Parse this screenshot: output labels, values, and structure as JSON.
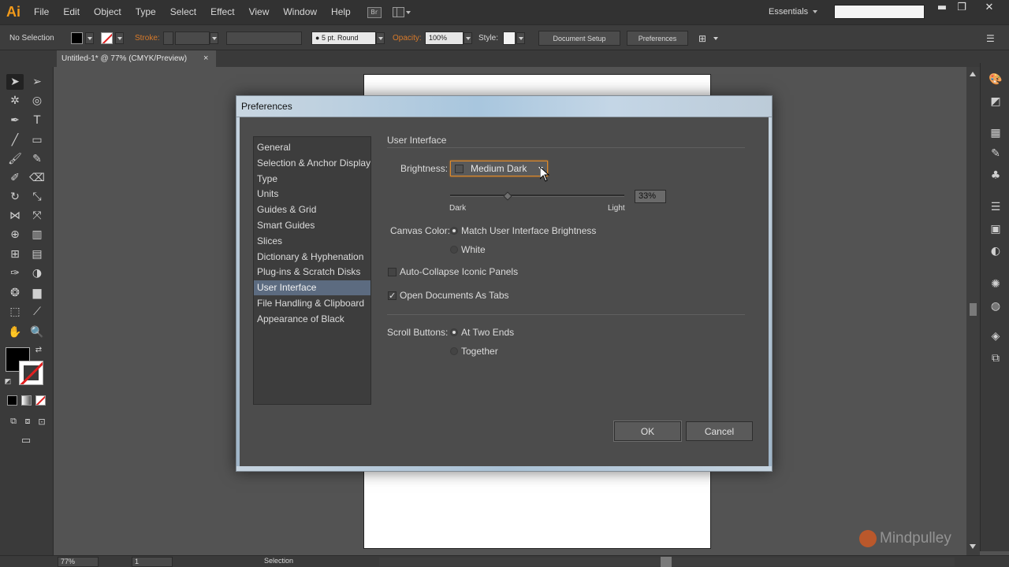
{
  "app": {
    "logo": "Ai",
    "menu": [
      "File",
      "Edit",
      "Object",
      "Type",
      "Select",
      "Effect",
      "View",
      "Window",
      "Help"
    ],
    "workspace": "Essentials",
    "window_controls": {
      "minimize": "▬",
      "restore": "❐",
      "close": "✕"
    }
  },
  "control_bar": {
    "selection_state": "No Selection",
    "stroke_label": "Stroke:",
    "brush_value": "5 pt. Round",
    "opacity_label": "Opacity:",
    "opacity_value": "100%",
    "style_label": "Style:",
    "document_setup_button": "Document Setup",
    "preferences_button": "Preferences"
  },
  "document_tab": {
    "title": "Untitled-1* @ 77% (CMYK/Preview)",
    "close": "×"
  },
  "status_bar": {
    "zoom": "77%",
    "artboard": "1",
    "tool_status": "Selection"
  },
  "dialog": {
    "title": "Preferences",
    "categories": [
      "General",
      "Selection & Anchor Display",
      "Type",
      "Units",
      "Guides & Grid",
      "Smart Guides",
      "Slices",
      "Dictionary & Hyphenation",
      "Plug-ins & Scratch Disks",
      "User Interface",
      "File Handling & Clipboard",
      "Appearance of Black"
    ],
    "selected_category_index": 9,
    "section_title": "User Interface",
    "brightness_label": "Brightness:",
    "brightness_value": "Medium Dark",
    "slider_min_label": "Dark",
    "slider_max_label": "Light",
    "slider_value": "33%",
    "slider_fraction": 0.33,
    "canvas_color_label": "Canvas Color:",
    "canvas_color_options": [
      "Match User Interface Brightness",
      "White"
    ],
    "canvas_color_selected": 0,
    "auto_collapse_label": "Auto-Collapse Iconic Panels",
    "auto_collapse_checked": false,
    "open_docs_tabs_label": "Open Documents As Tabs",
    "open_docs_tabs_checked": true,
    "scroll_buttons_label": "Scroll Buttons:",
    "scroll_buttons_options": [
      "At Two Ends",
      "Together"
    ],
    "scroll_buttons_selected": 0,
    "ok_button": "OK",
    "cancel_button": "Cancel"
  },
  "watermark": "Mindpulley",
  "colors": {
    "accent_orange": "#e08a2a",
    "selection_blue": "#5c6b80",
    "title_gradient": "#bcd0e0"
  }
}
